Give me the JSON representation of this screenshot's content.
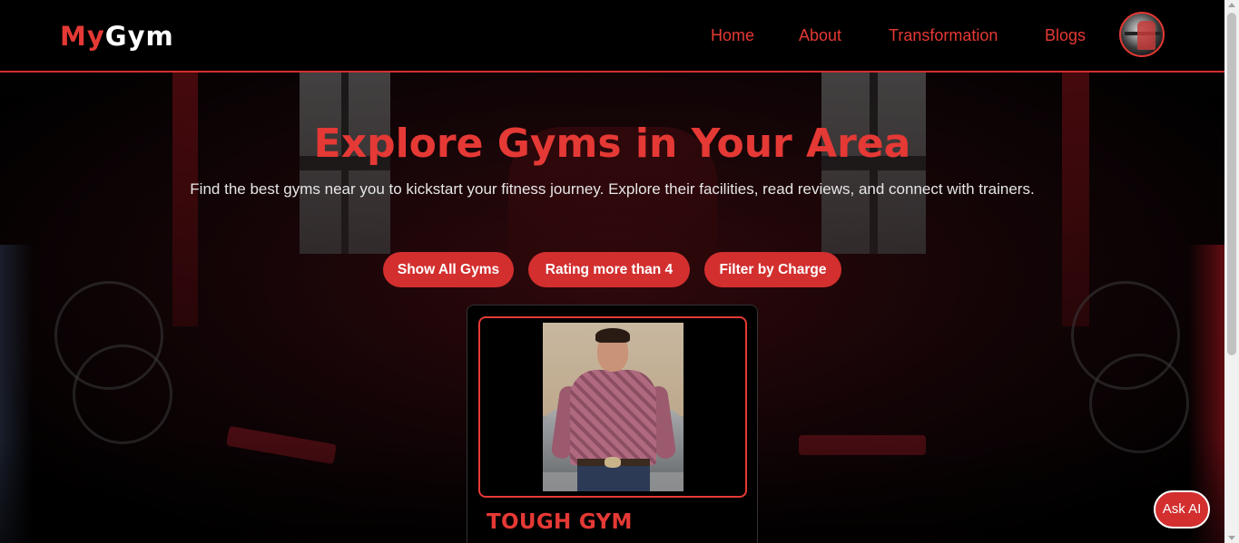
{
  "brand": {
    "logo_part1": "My",
    "logo_part2": "Gym",
    "accent_color": "#e53935",
    "button_color": "#d32f2f"
  },
  "nav": {
    "items": [
      {
        "label": "Home"
      },
      {
        "label": "About"
      },
      {
        "label": "Transformation"
      },
      {
        "label": "Blogs"
      }
    ],
    "avatar_icon": "user-avatar"
  },
  "hero": {
    "title": "Explore Gyms in Your Area",
    "subtitle": "Find the best gyms near you to kickstart your fitness journey. Explore their facilities, read reviews, and connect with trainers."
  },
  "filters": [
    {
      "label": "Show All Gyms"
    },
    {
      "label": "Rating more than 4"
    },
    {
      "label": "Filter by Charge"
    }
  ],
  "gyms": [
    {
      "name": "TOUGH GYM"
    }
  ],
  "ask_ai": {
    "label": "Ask AI"
  }
}
